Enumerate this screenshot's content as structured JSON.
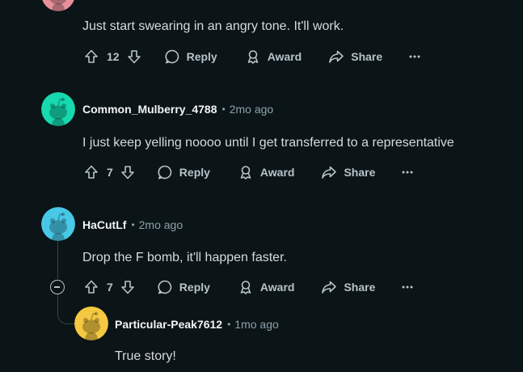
{
  "colors": {
    "background": "#0b1416",
    "text": "#d7dadc",
    "muted": "#8ba2ad",
    "action": "#b7c3ca"
  },
  "actions": {
    "reply": "Reply",
    "award": "Award",
    "share": "Share"
  },
  "comments": [
    {
      "body": "Just start swearing in an angry tone. It'll work.",
      "votes": "12",
      "avatar_color": "#e8909a"
    },
    {
      "username": "Common_Mulberry_4788",
      "time": "2mo ago",
      "body": "I just keep yelling noooo until I get transferred to a representative",
      "votes": "7",
      "avatar_color": "#17d9b0"
    },
    {
      "username": "HaCutLf",
      "time": "2mo ago",
      "body": "Drop the F bomb, it'll happen faster.",
      "votes": "7",
      "avatar_color": "#47c8e6"
    },
    {
      "username": "Particular-Peak7612",
      "time": "1mo ago",
      "body": "True story!",
      "avatar_color": "#f5c842"
    }
  ]
}
